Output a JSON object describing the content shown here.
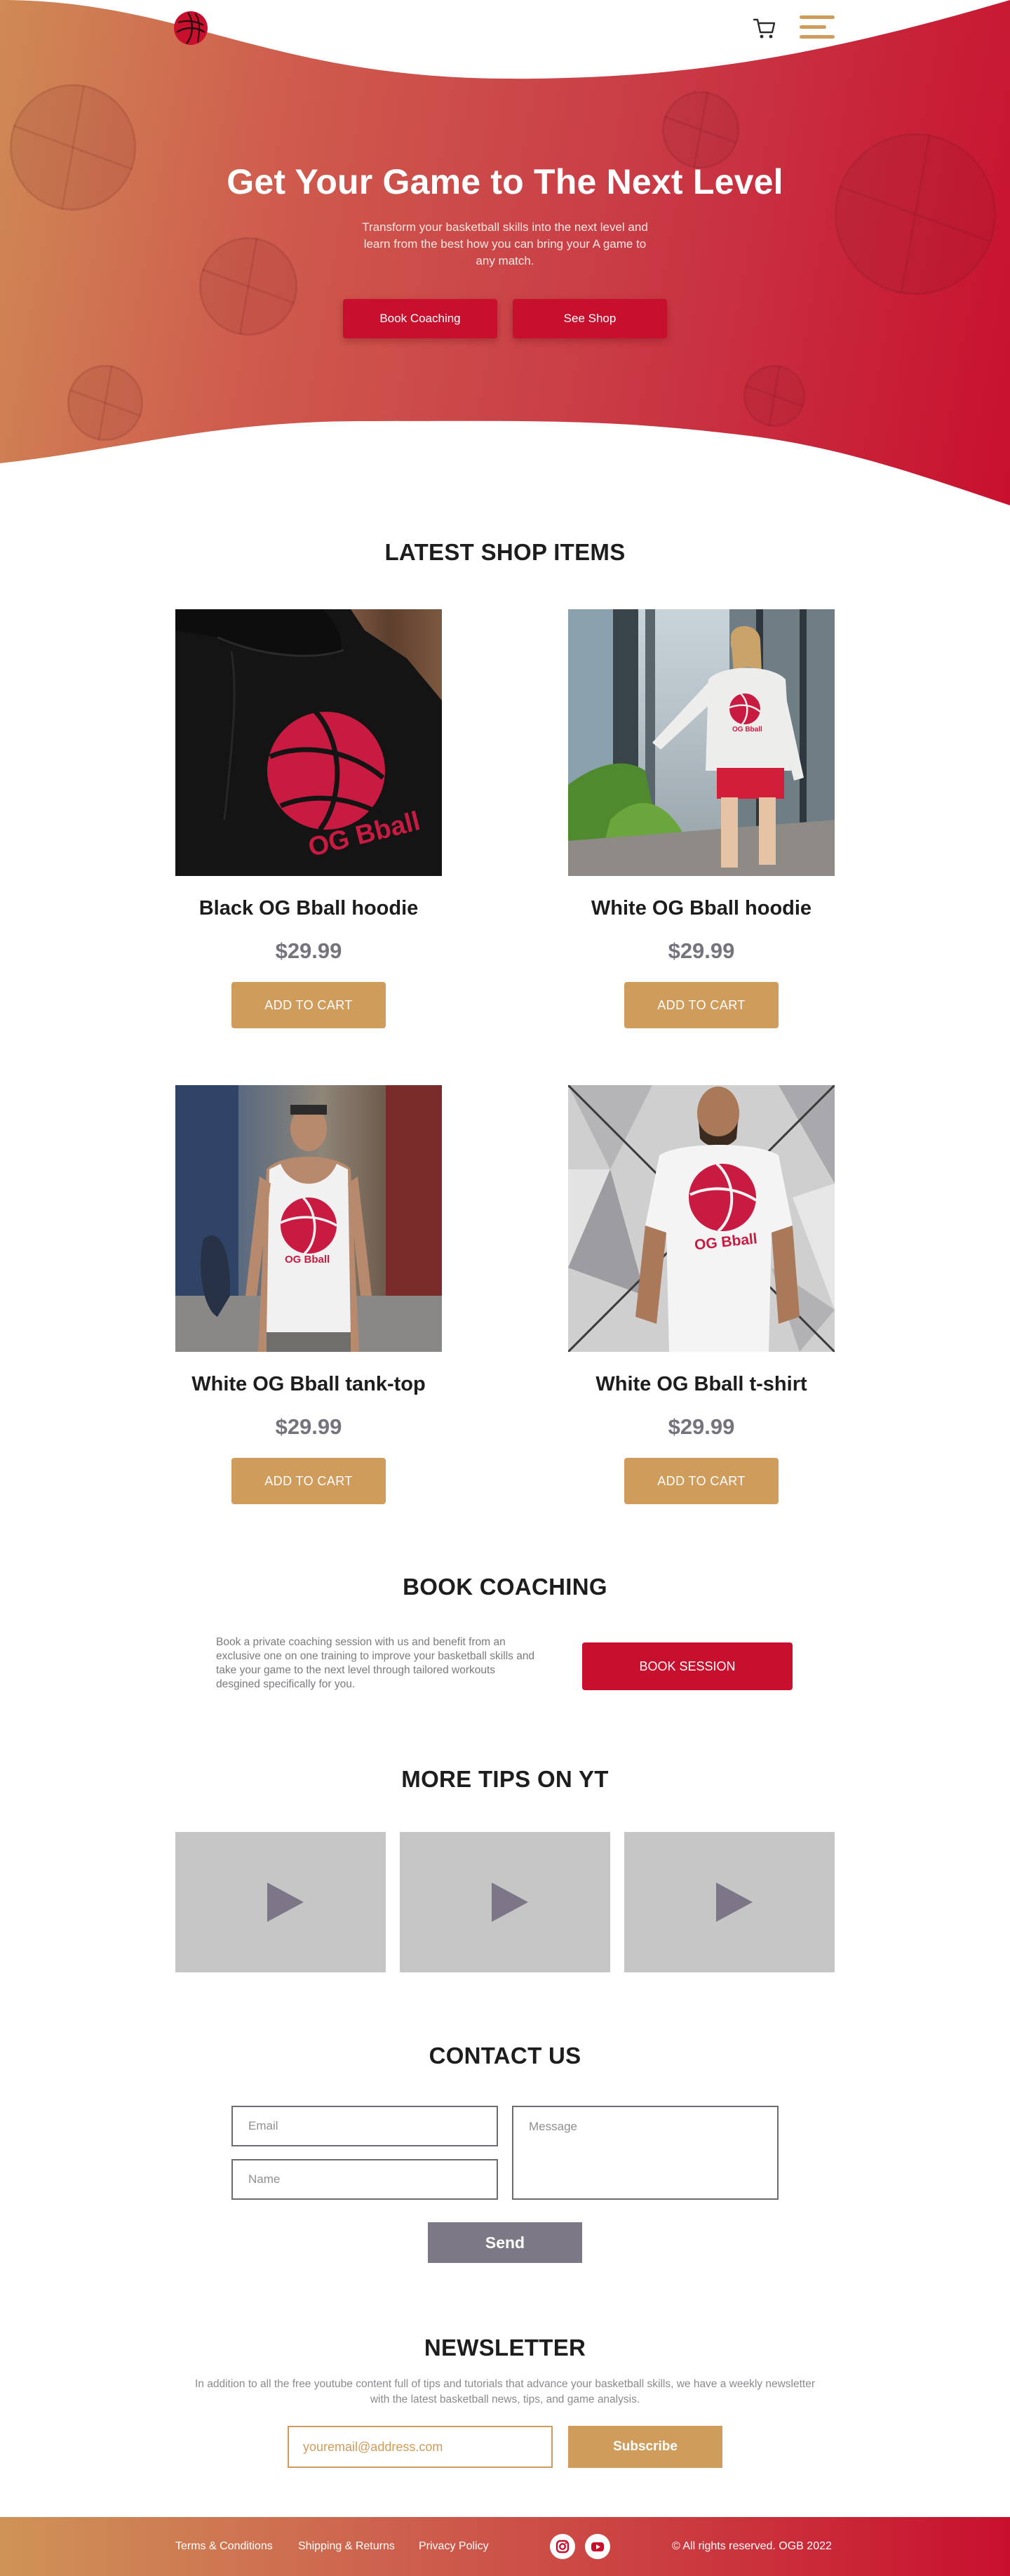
{
  "header": {
    "cart_icon": "shopping-cart-icon",
    "menu_icon": "hamburger-menu-icon",
    "logo_icon": "basketball-icon"
  },
  "hero": {
    "title": "Get Your Game to The Next Level",
    "subtitle": "Transform your basketball skills into the next level and learn from the best how you can bring your A game to any match.",
    "primary_button": "Book Coaching",
    "secondary_button": "See Shop"
  },
  "shop": {
    "title": "LATEST SHOP ITEMS",
    "items": [
      {
        "name": "Black OG Bball hoodie",
        "price": "$29.99",
        "button": "ADD TO CART",
        "print": "OG Bball"
      },
      {
        "name": "White OG Bball hoodie",
        "price": "$29.99",
        "button": "ADD TO CART",
        "print": "OG Bball"
      },
      {
        "name": "White OG Bball tank-top",
        "price": "$29.99",
        "button": "ADD TO CART",
        "print": "OG Bball"
      },
      {
        "name": "White OG Bball t-shirt",
        "price": "$29.99",
        "button": "ADD TO CART",
        "print": "OG Bball"
      }
    ]
  },
  "coaching": {
    "title": "BOOK COACHING",
    "text": "Book a private coaching session with us and benefit from an exclusive one on one training to improve your basketball skills and take your game to the next level through tailored workouts desgined specifically for you.",
    "button": "BOOK SESSION"
  },
  "videos": {
    "title": "MORE TIPS ON YT",
    "count": 3,
    "play_icon": "play-icon"
  },
  "contact": {
    "title": "CONTACT US",
    "email_placeholder": "Email",
    "name_placeholder": "Name",
    "message_placeholder": "Message",
    "send_button": "Send"
  },
  "newsletter": {
    "title": "NEWSLETTER",
    "text": "In addition to all the free youtube content full of tips and tutorials that advance your basketball skills, we have a weekly newsletter with the latest basketball news, tips, and game analysis.",
    "email_placeholder": "youremail@address.com",
    "button": "Subscribe"
  },
  "footer": {
    "links": [
      "Terms & Conditions",
      "Shipping & Returns",
      "Privacy Policy"
    ],
    "social_icons": [
      "instagram-icon",
      "youtube-icon"
    ],
    "copyright": "© All rights reserved. OGB 2022"
  },
  "colors": {
    "brand_red": "#c8102e",
    "accent_gold": "#d09c5b",
    "muted_purple": "#7d7886"
  }
}
